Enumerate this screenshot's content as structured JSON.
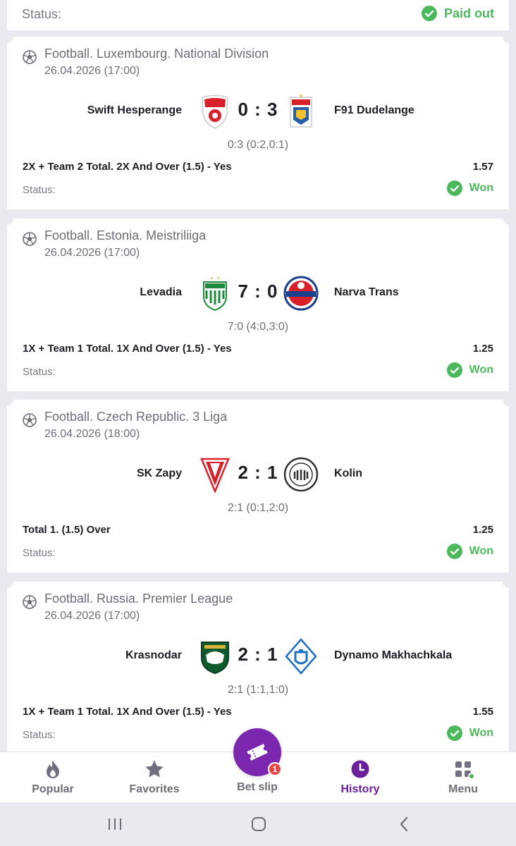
{
  "header": {
    "status_label": "Status:",
    "status_value": "Paid out"
  },
  "matches": [
    {
      "league": "Football. Luxembourg. National Division",
      "date": "26.04.2026 (17:00)",
      "team1": "Swift Hesperange",
      "team2": "F91 Dudelange",
      "score": "0 : 3",
      "detail": "0:3 (0:2,0:1)",
      "bet": "2X + Team 2 Total. 2X And Over (1.5) - Yes",
      "odds": "1.57",
      "status_label": "Status:",
      "status": "Won"
    },
    {
      "league": "Football. Estonia. Meistriliiga",
      "date": "26.04.2026 (17:00)",
      "team1": "Levadia",
      "team2": "Narva Trans",
      "score": "7 : 0",
      "detail": "7:0 (4:0,3:0)",
      "bet": "1X + Team 1 Total. 1X And Over (1.5) - Yes",
      "odds": "1.25",
      "status_label": "Status:",
      "status": "Won"
    },
    {
      "league": "Football. Czech Republic. 3 Liga",
      "date": "26.04.2026 (18:00)",
      "team1": "SK Zapy",
      "team2": "Kolin",
      "score": "2 : 1",
      "detail": "2:1 (0:1,2:0)",
      "bet": "Total 1. (1.5) Over",
      "odds": "1.25",
      "status_label": "Status:",
      "status": "Won"
    },
    {
      "league": "Football. Russia. Premier League",
      "date": "26.04.2026 (17:00)",
      "team1": "Krasnodar",
      "team2": "Dynamo Makhachkala",
      "score": "2 : 1",
      "detail": "2:1 (1:1,1:0)",
      "bet": "1X + Team 1 Total. 1X And Over (1.5) - Yes",
      "odds": "1.55",
      "status_label": "Status:",
      "status": "Won"
    }
  ],
  "nav": {
    "popular": "Popular",
    "favorites": "Favorites",
    "betslip": "Bet slip",
    "betslip_count": "1",
    "history": "History",
    "menu": "Menu"
  },
  "colors": {
    "accent": "#7b27b0",
    "success": "#4cb85c",
    "badge": "#e54545"
  }
}
